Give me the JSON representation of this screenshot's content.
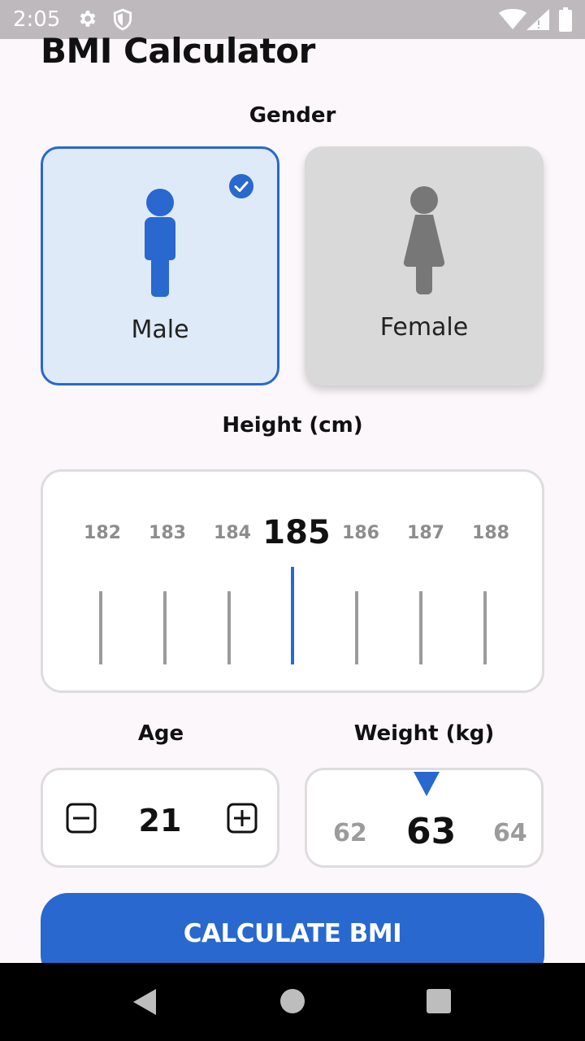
{
  "status": {
    "time": "2:05",
    "icons": [
      "gear-icon",
      "shield-icon",
      "wifi-icon",
      "signal-icon",
      "battery-icon"
    ]
  },
  "title": "BMI Calculator",
  "gender": {
    "label": "Gender",
    "selected": "Male",
    "options": [
      {
        "label": "Male",
        "icon": "male-figure-icon",
        "selected": true
      },
      {
        "label": "Female",
        "icon": "female-figure-icon",
        "selected": false
      }
    ]
  },
  "height": {
    "label": "Height (cm)",
    "ticks": [
      "182",
      "183",
      "184",
      "185",
      "186",
      "187",
      "188"
    ],
    "selected": "185"
  },
  "age": {
    "label": "Age",
    "value": "21",
    "decrement_icon": "minus-box-icon",
    "increment_icon": "plus-box-icon"
  },
  "weight": {
    "label": "Weight (kg)",
    "prev": "62",
    "value": "63",
    "next": "64"
  },
  "action": {
    "calculate_label": "CALCULATE BMI"
  },
  "colors": {
    "accent": "#2868cf",
    "background": "#fcf7fb",
    "selected_card": "#dfeaf8",
    "unselected_card": "#d9d9d9"
  }
}
